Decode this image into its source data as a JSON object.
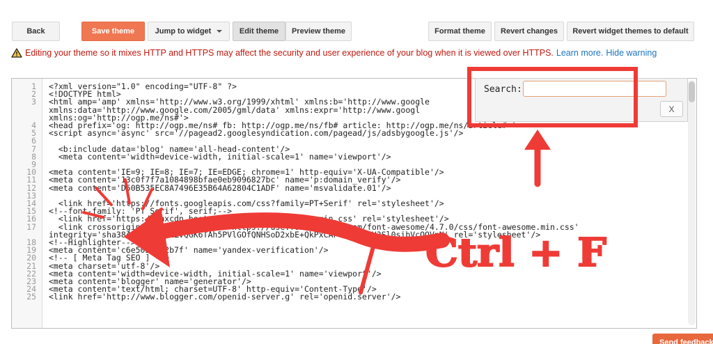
{
  "toolbar": {
    "back": "Back",
    "save_theme": "Save theme",
    "jump_to_widget": "Jump to widget",
    "edit_theme": "Edit theme",
    "preview_theme": "Preview theme",
    "format_theme": "Format theme",
    "revert_changes": "Revert changes",
    "revert_widget_themes": "Revert widget themes to default"
  },
  "warning": {
    "icon": "warning-triangle-icon",
    "text": "Editing your theme so it mixes HTTP and HTTPS may affect the security and user experience of your blog when it is viewed over HTTPS.",
    "learn_more": "Learn more.",
    "hide_warning": "Hide warning"
  },
  "editor": {
    "lines": [
      {
        "no": "1",
        "text": "<?xml version=\"1.0\" encoding=\"UTF-8\" ?>"
      },
      {
        "no": "2",
        "text": "<!DOCTYPE html>"
      },
      {
        "no": "3",
        "text": "<html amp='amp' xmlns='http://www.w3.org/1999/xhtml' xmlns:b='http://www.google"
      },
      {
        "no": "",
        "text": "xmlns:data='http://www.google.com/2005/gml/data' xmlns:expr='http://www.googl"
      },
      {
        "no": "",
        "text": "xmlns:og='http://ogp.me/ns#'>"
      },
      {
        "no": "4",
        "text": "<head prefix='og: http://ogp.me/ns# fb: http://ogp.me/ns/fb# article: http://ogp.me/ns/article# '>"
      },
      {
        "no": "5",
        "text": "<script async='async' src='//pagead2.googlesyndication.com/pagead/js/adsbygoogle.js'/>"
      },
      {
        "no": "6",
        "text": ""
      },
      {
        "no": "7",
        "text": "  <b:include data='blog' name='all-head-content'/>"
      },
      {
        "no": "8",
        "text": "  <meta content='width=device-width, initial-scale=1' name='viewport'/>"
      },
      {
        "no": "9",
        "text": ""
      },
      {
        "no": "10",
        "text": "<meta content='IE=9; IE=8; IE=7; IE=EDGE; chrome=1' http-equiv='X-UA-Compatible'/>"
      },
      {
        "no": "11",
        "text": "<meta content='13c0f7f7a1084898bfae0eb9096827bc' name='p:domain_verify'/>"
      },
      {
        "no": "12",
        "text": "<meta content='D50B535EC8A7496E35B64A62804C1ADF' name='msvalidate.01'/>"
      },
      {
        "no": "13",
        "text": ""
      },
      {
        "no": "14",
        "text": "  <link href='https://fonts.googleapis.com/css?family=PT+Serif' rel='stylesheet'/>"
      },
      {
        "no": "15",
        "text": "<!--font-family: 'PT Serif', serif;-->"
      },
      {
        "no": "16",
        "text": "  <link href='https://maxcdn.bootstrapcdn.com/bootstrap.min.css' rel='stylesheet'/>"
      },
      {
        "no": "17",
        "text": "  <link crossorigin='anonymous' href='https://use.fontawesome.com/font-awesome/4.7.0/css/font-awesome.min.css'"
      },
      {
        "no": "",
        "text": "integrity='sha384-wvfXpqpZZVQGK6TAh5PVlGOfQNHSoD2xbE+QkPxCAFlNEevoEH3Sl0sibVcOQVnN' rel='stylesheet'/>"
      },
      {
        "no": "18",
        "text": "<!--Highlighter-->"
      },
      {
        "no": "19",
        "text": "<meta content='c6e5037602b7f' name='yandex-verification'/>"
      },
      {
        "no": "20",
        "text": "<!-- [ Meta Tag SEO ] -->"
      },
      {
        "no": "21",
        "text": "<meta charset='utf-8'/>"
      },
      {
        "no": "22",
        "text": "<meta content='width=device-width, initial-scale=1' name='viewport'/>"
      },
      {
        "no": "23",
        "text": "<meta content='blogger' name='generator'/>"
      },
      {
        "no": "24",
        "text": "<meta content='text/html; charset=UTF-8' http-equiv='Content-Type'/>"
      },
      {
        "no": "25",
        "text": "<link href='http://www.blogger.com/openid-server.g' rel='openid.server'/>"
      }
    ]
  },
  "search": {
    "label": "Search:",
    "value": "",
    "close": "X"
  },
  "annotation": {
    "shortcut": "Ctrl + F",
    "color": "#ef3b36"
  },
  "feedback": "Send feedback",
  "colors": {
    "primary": "#ef7752",
    "warning": "#c0190f",
    "link": "#1b74c0"
  }
}
